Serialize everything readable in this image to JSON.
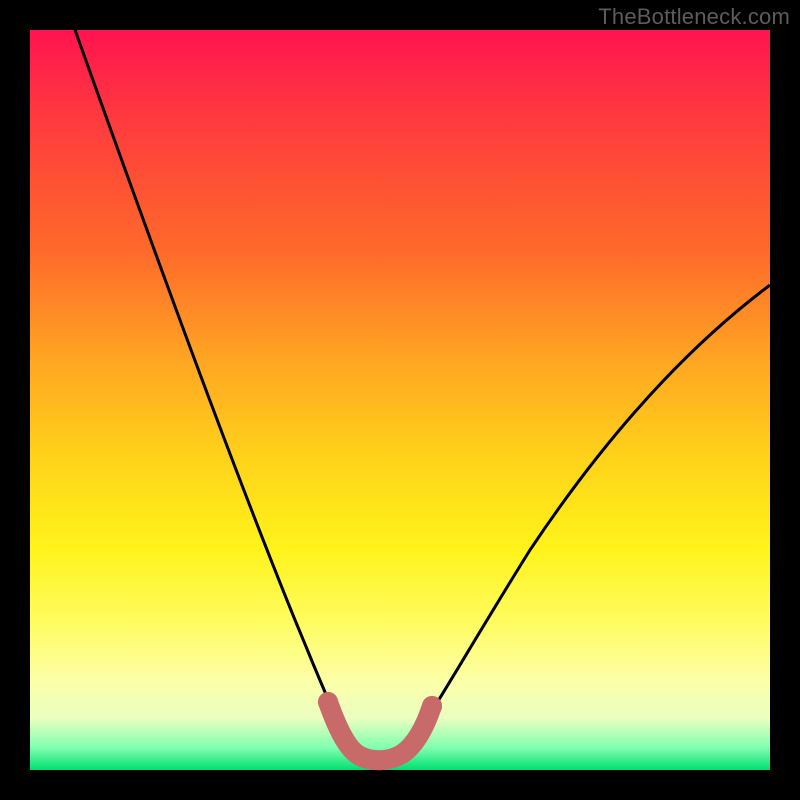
{
  "watermark": "TheBottleneck.com",
  "chart_data": {
    "type": "line",
    "title": "",
    "xlabel": "",
    "ylabel": "",
    "xlim": [
      0,
      100
    ],
    "ylim": [
      0,
      100
    ],
    "series": [
      {
        "name": "bottleneck-curve",
        "x": [
          2,
          6,
          10,
          14,
          18,
          22,
          26,
          30,
          33,
          36,
          38,
          40,
          42,
          44,
          46,
          48,
          52,
          56,
          60,
          66,
          72,
          80,
          88,
          96,
          100
        ],
        "y": [
          100,
          92,
          84,
          76,
          68,
          59,
          50,
          40,
          31,
          22,
          15,
          9,
          5,
          3,
          3,
          5,
          10,
          16,
          23,
          32,
          40,
          49,
          56,
          62,
          65
        ]
      },
      {
        "name": "optimal-band",
        "x": [
          38,
          40,
          42,
          44,
          46,
          48
        ],
        "y": [
          9,
          4,
          2,
          2,
          4,
          9
        ]
      }
    ],
    "colors": {
      "curve": "#000000",
      "band": "#c96a6a",
      "gradient_top": "#ff1450",
      "gradient_bottom": "#00e070"
    }
  }
}
